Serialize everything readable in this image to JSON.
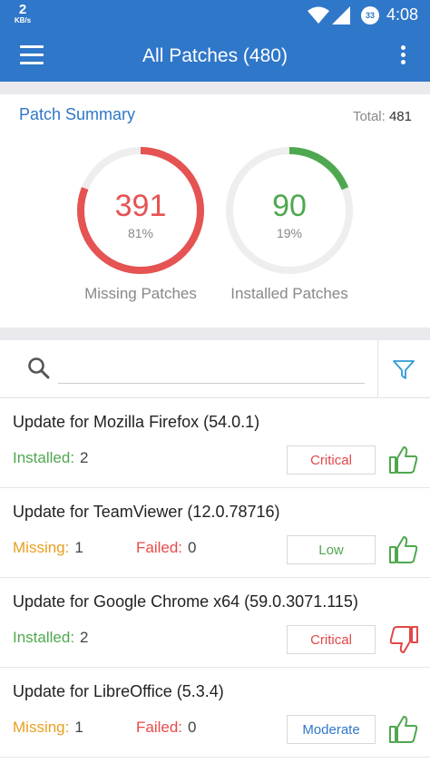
{
  "status_bar": {
    "speed_value": "2",
    "speed_unit": "KB/s",
    "battery": "33",
    "time": "4:08",
    "icons": [
      "wifi-icon",
      "signal-icon",
      "battery-icon"
    ]
  },
  "app_bar": {
    "title": "All Patches (480)",
    "menu_icon": "hamburger-menu-icon",
    "overflow_icon": "more-vert-icon"
  },
  "summary": {
    "title": "Patch Summary",
    "total_label": "Total:",
    "total_value": "481",
    "missing": {
      "count": "391",
      "percent": "81%",
      "label": "Missing Patches",
      "fraction": 0.81,
      "color": "#e55353"
    },
    "installed": {
      "count": "90",
      "percent": "19%",
      "label": "Installed Patches",
      "fraction": 0.19,
      "color": "#4fa84f"
    }
  },
  "search": {
    "value": "",
    "placeholder": "",
    "search_icon": "search-icon",
    "filter_icon": "filter-icon"
  },
  "patches": [
    {
      "title": "Update for Mozilla Firefox (54.0.1)",
      "stats": [
        {
          "label": "Installed:",
          "value": "2",
          "kind": "installed"
        }
      ],
      "severity": "Critical",
      "severity_kind": "critical",
      "vote": "thumbs-up-icon"
    },
    {
      "title": "Update for TeamViewer (12.0.78716)",
      "stats": [
        {
          "label": "Missing:",
          "value": "1",
          "kind": "missing"
        },
        {
          "label": "Failed:",
          "value": "0",
          "kind": "failed"
        }
      ],
      "severity": "Low",
      "severity_kind": "low",
      "vote": "thumbs-up-icon"
    },
    {
      "title": "Update for Google Chrome x64 (59.0.3071.115)",
      "stats": [
        {
          "label": "Installed:",
          "value": "2",
          "kind": "installed"
        }
      ],
      "severity": "Critical",
      "severity_kind": "critical",
      "vote": "thumbs-down-icon"
    },
    {
      "title": "Update for LibreOffice (5.3.4)",
      "stats": [
        {
          "label": "Missing:",
          "value": "1",
          "kind": "missing"
        },
        {
          "label": "Failed:",
          "value": "0",
          "kind": "failed"
        }
      ],
      "severity": "Moderate",
      "severity_kind": "moderate",
      "vote": "thumbs-up-icon"
    }
  ],
  "colors": {
    "primary": "#2f77c9",
    "installed": "#4fa84f",
    "missing": "#e8a020",
    "failed": "#e84a4a",
    "critical": "#e04848"
  }
}
